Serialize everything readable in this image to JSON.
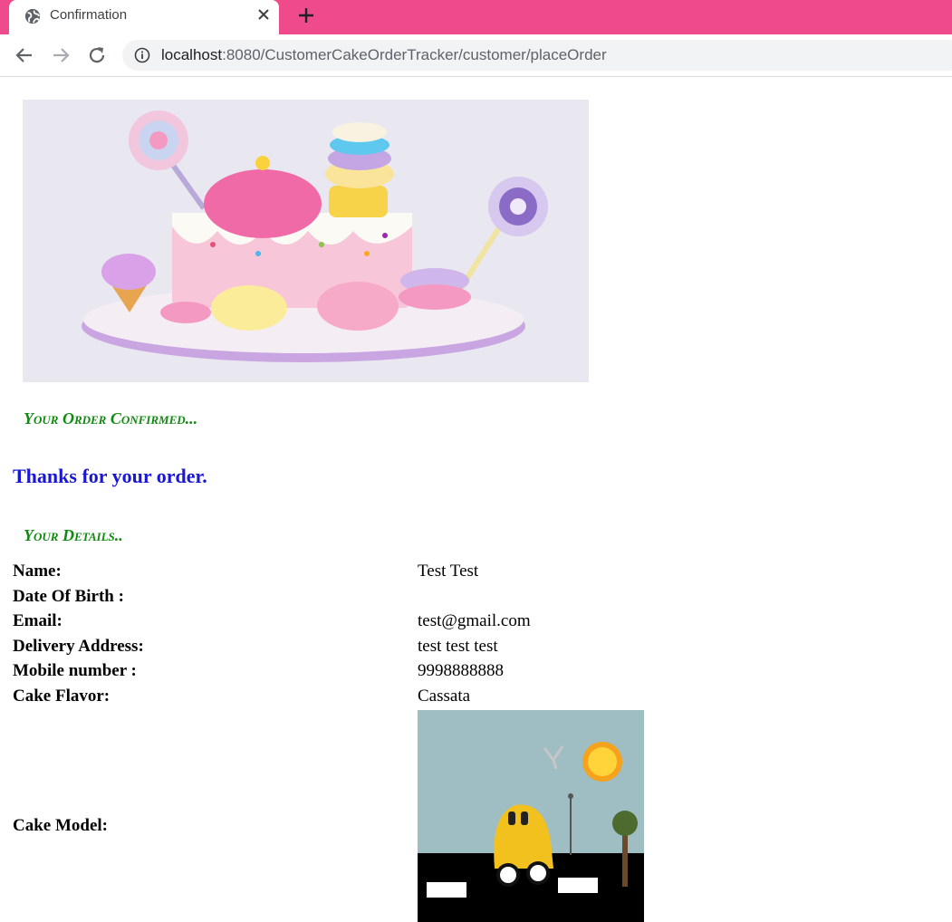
{
  "browser": {
    "tab_title": "Confirmation",
    "url_host": "localhost",
    "url_rest": ":8080/CustomerCakeOrderTracker/customer/placeOrder",
    "accent_color": "#ee4a8c"
  },
  "page": {
    "order_confirmed_heading": "Your Order Confirmed...",
    "thanks_message": "Thanks for your order.",
    "details_heading": "Your Details..",
    "heading_color": "#0f8a0f",
    "thanks_color": "#1a16d8"
  },
  "details": [
    {
      "label": "Name:",
      "value": "Test Test"
    },
    {
      "label": "Date Of Birth :",
      "value": ""
    },
    {
      "label": "Email:",
      "value": "test@gmail.com"
    },
    {
      "label": "Delivery Address:",
      "value": "test test test"
    },
    {
      "label": "Mobile number :",
      "value": "9998888888"
    },
    {
      "label": "Cake Flavor:",
      "value": "Cassata"
    }
  ],
  "cake_model": {
    "label": "Cake Model:"
  },
  "icons": [
    "globe-icon",
    "close-icon",
    "plus-icon",
    "back-arrow-icon",
    "forward-arrow-icon",
    "reload-icon",
    "info-icon"
  ]
}
